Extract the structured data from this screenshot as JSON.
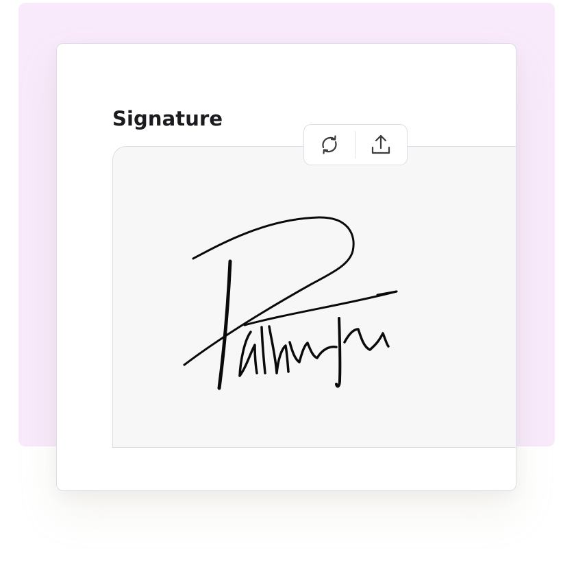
{
  "form": {
    "signature_label": "Signature"
  },
  "toolbar": {
    "reset_icon": "refresh-icon",
    "upload_icon": "upload-icon"
  },
  "colors": {
    "backdrop": "#f8eafb",
    "card": "#ffffff",
    "pad": "#f7f7f7",
    "ink": "#0a0a0a",
    "border": "#dcdde6"
  }
}
